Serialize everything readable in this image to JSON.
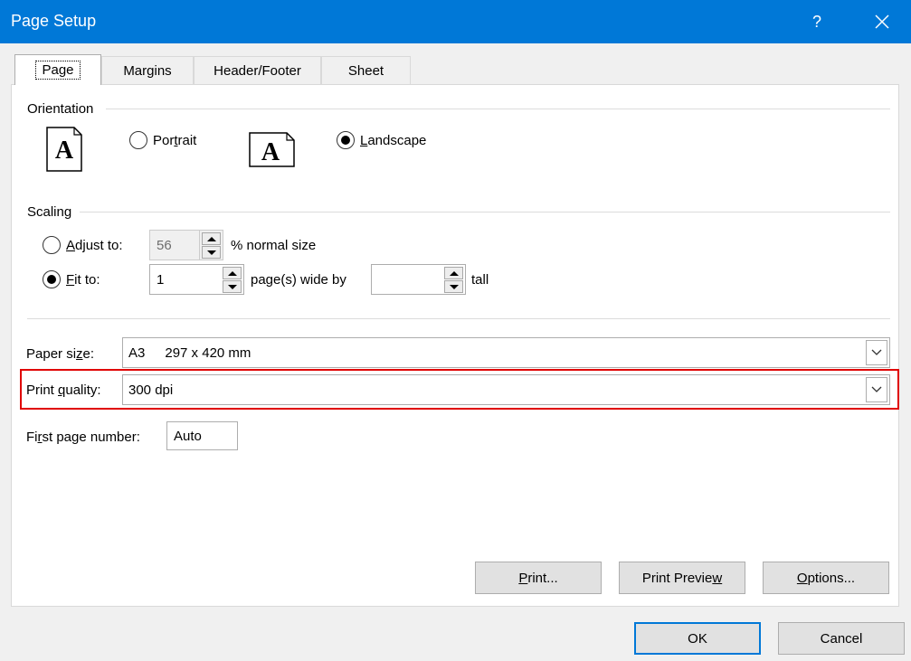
{
  "window": {
    "title": "Page Setup",
    "help_label": "?"
  },
  "tabs": [
    {
      "label": "Page",
      "active": true
    },
    {
      "label": "Margins"
    },
    {
      "label": "Header/Footer"
    },
    {
      "label": "Sheet"
    }
  ],
  "orientation": {
    "heading": "Orientation",
    "portrait_label": "Portrait",
    "landscape_label": "Landscape",
    "page_icon_letter": "A",
    "selected": "Landscape"
  },
  "scaling": {
    "heading": "Scaling",
    "adjust_label": "Adjust to:",
    "adjust_value": "56",
    "adjust_suffix": "% normal size",
    "fit_label": "Fit to:",
    "fit_wide_value": "1",
    "fit_wide_suffix": "page(s) wide by",
    "fit_tall_value": "",
    "fit_tall_suffix": "tall",
    "selected": "Fit to"
  },
  "paper_size": {
    "label": "Paper size:",
    "value_code": "A3",
    "value_dims": "297 x 420 mm"
  },
  "print_quality": {
    "label": "Print quality:",
    "value": "300 dpi"
  },
  "first_page": {
    "label": "First page number:",
    "value": "Auto"
  },
  "panel_buttons": {
    "print": "Print...",
    "print_preview": "Print Preview",
    "options": "Options..."
  },
  "footer_buttons": {
    "ok": "OK",
    "cancel": "Cancel"
  },
  "colors": {
    "titlebar": "#0078d7",
    "highlight": "#e00000"
  }
}
